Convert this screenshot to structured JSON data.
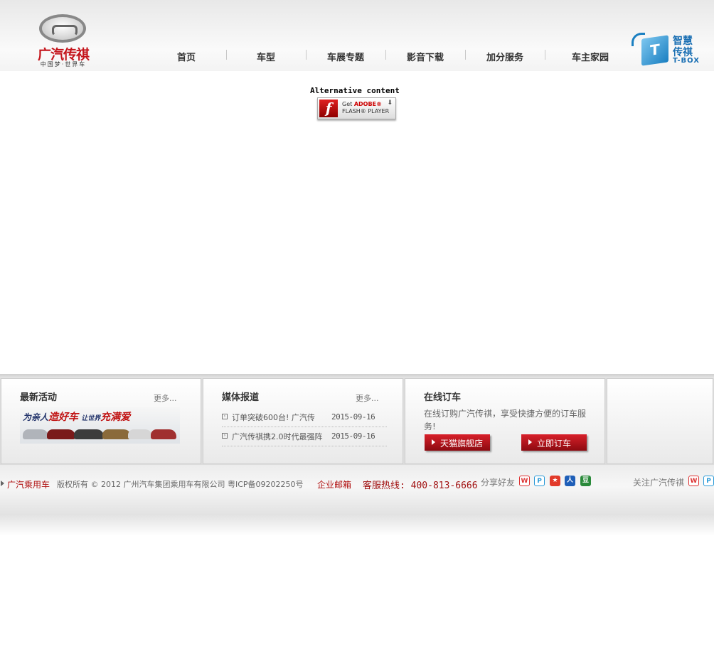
{
  "header": {
    "brand": "广汽传祺",
    "slogan": "中国梦·世界车",
    "nav": [
      "首页",
      "车型",
      "车展专题",
      "影音下载",
      "加分服务",
      "车主家园"
    ],
    "tbox_title": "智慧传祺",
    "tbox_sub": "T-BOX"
  },
  "flash": {
    "alt_text": "Alternative content",
    "badge_line1_prefix": "Get ",
    "badge_line1_brand": "ADOBE®",
    "badge_line2": "FLASH® PLAYER",
    "badge_icon": "f"
  },
  "panels": {
    "activity": {
      "title": "最新活动",
      "more": "更多...",
      "banner_a": "为亲人",
      "banner_b": "造好车",
      "banner_c": "让世界",
      "banner_d": "充满爱"
    },
    "media": {
      "title": "媒体报道",
      "more": "更多...",
      "items": [
        {
          "title": "订单突破600台! 广汽传",
          "date": "2015-09-16"
        },
        {
          "title": "广汽传祺携2.0时代最强阵",
          "date": "2015-09-16"
        }
      ]
    },
    "order": {
      "title": "在线订车",
      "desc": "在线订购广汽传祺，享受快捷方便的订车服务!",
      "tmall_button": "天猫旗舰店",
      "order_button": "立即订车"
    }
  },
  "footer": {
    "brand": "广汽乘用车",
    "copyright": "版权所有 © 2012 广州汽车集团乘用车有限公司 粤ICP备09202250号",
    "mail": "企业邮箱",
    "hotline": "客服热线: 400-813-6666",
    "share_label": "分享好友",
    "follow_label": "关注广汽传祺"
  },
  "colors": {
    "brand_red": "#c4141b",
    "tbox_blue": "#1a7fc1"
  }
}
